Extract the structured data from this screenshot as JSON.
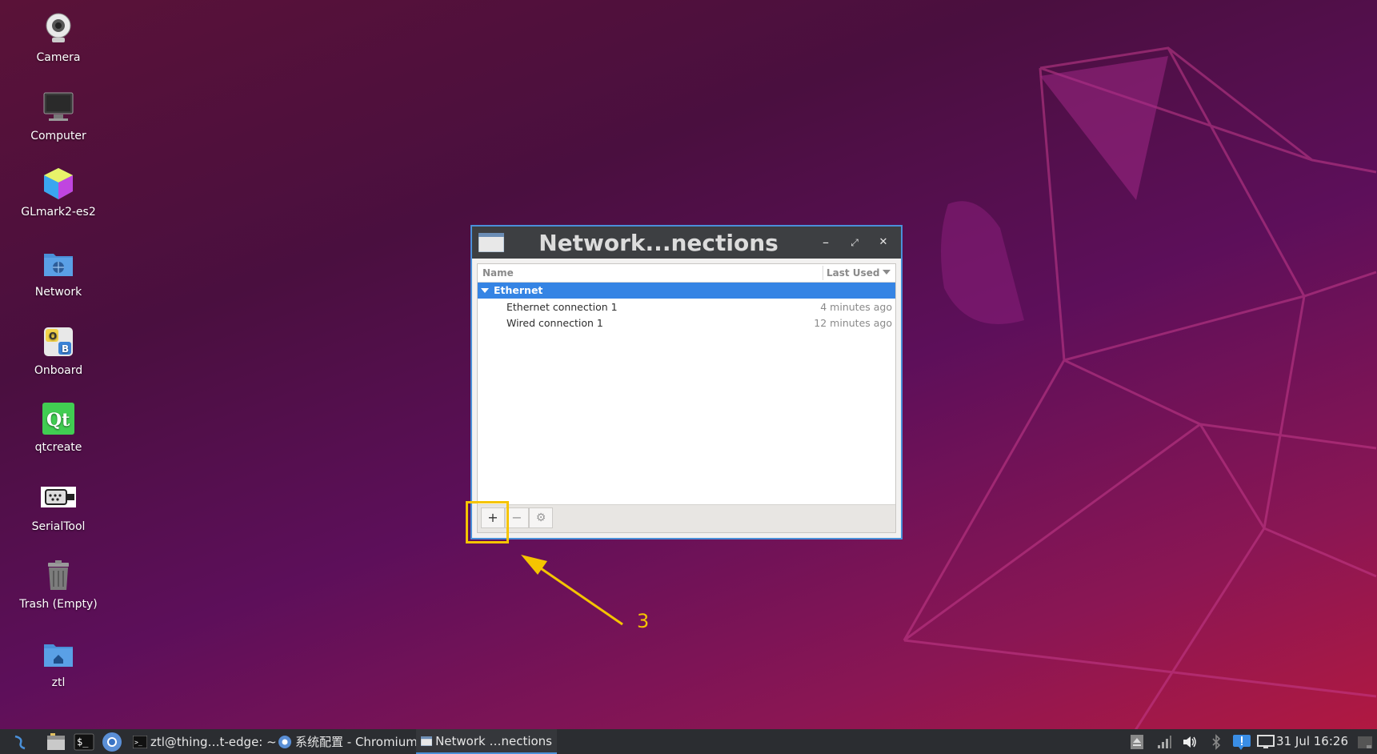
{
  "desktop": {
    "icons": [
      {
        "label": "Camera"
      },
      {
        "label": "Computer"
      },
      {
        "label": "GLmark2-es2"
      },
      {
        "label": "Network"
      },
      {
        "label": "Onboard"
      },
      {
        "label": "qtcreate"
      },
      {
        "label": "SerialTool"
      },
      {
        "label": "Trash (Empty)"
      },
      {
        "label": "ztl"
      }
    ]
  },
  "window": {
    "title": "Network...nections",
    "minimize": "–",
    "maximize": "⤢",
    "close": "✕",
    "columns": {
      "name": "Name",
      "last_used": "Last Used"
    },
    "group": "Ethernet",
    "rows": [
      {
        "name": "Ethernet connection 1",
        "last_used": "4 minutes ago"
      },
      {
        "name": "Wired connection 1",
        "last_used": "12 minutes ago"
      }
    ],
    "toolbar": {
      "add": "+",
      "remove": "−",
      "settings": "⚙"
    }
  },
  "annotation": {
    "step": "3",
    "color": "#f5c400"
  },
  "taskbar": {
    "tasks": [
      {
        "label": "ztl@thing…t-edge: ~"
      },
      {
        "label": "系统配置 - Chromium"
      },
      {
        "label": "Network …nections"
      }
    ],
    "clock": "31 Jul 16:26"
  },
  "colors": {
    "accent": "#3584e4",
    "titlebar": "#3d3f42",
    "taskbar": "#2b2d31"
  }
}
